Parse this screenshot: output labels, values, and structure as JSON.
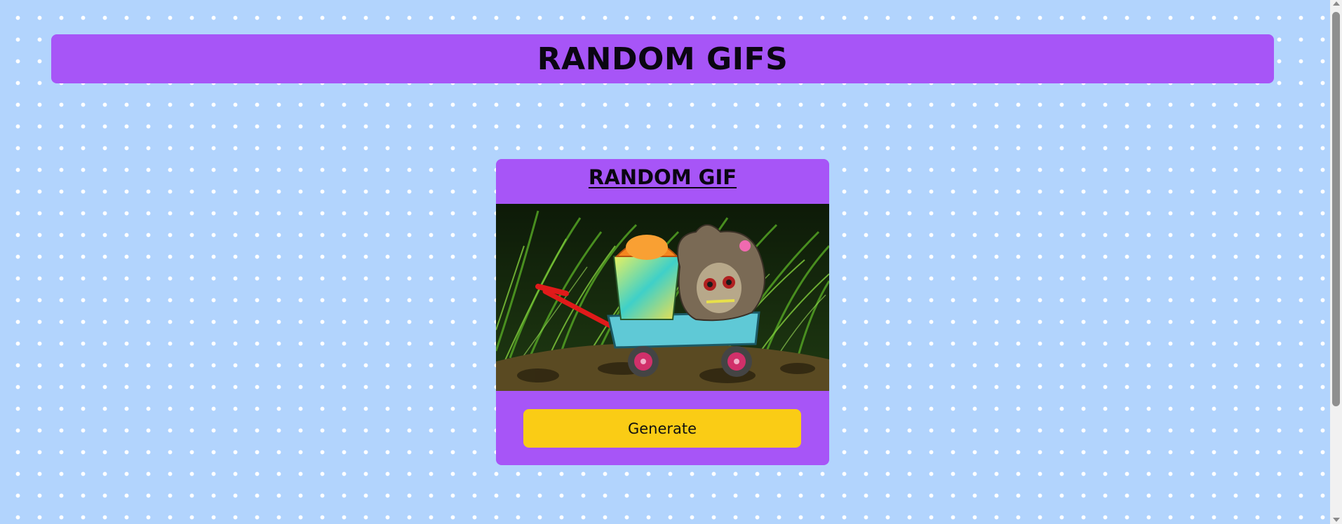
{
  "header": {
    "title": "RANDOM GIFS"
  },
  "card": {
    "title": "RANDOM GIF",
    "image_description": "random gif",
    "generate_label": "Generate"
  },
  "colors": {
    "background": "#b2d4fd",
    "dots": "#ffffff",
    "panel_purple": "#a755f7",
    "button_yellow": "#facc15",
    "title_text": "#0b0612"
  },
  "icons": [
    "scroll-up-arrow-icon",
    "scroll-down-arrow-icon"
  ]
}
